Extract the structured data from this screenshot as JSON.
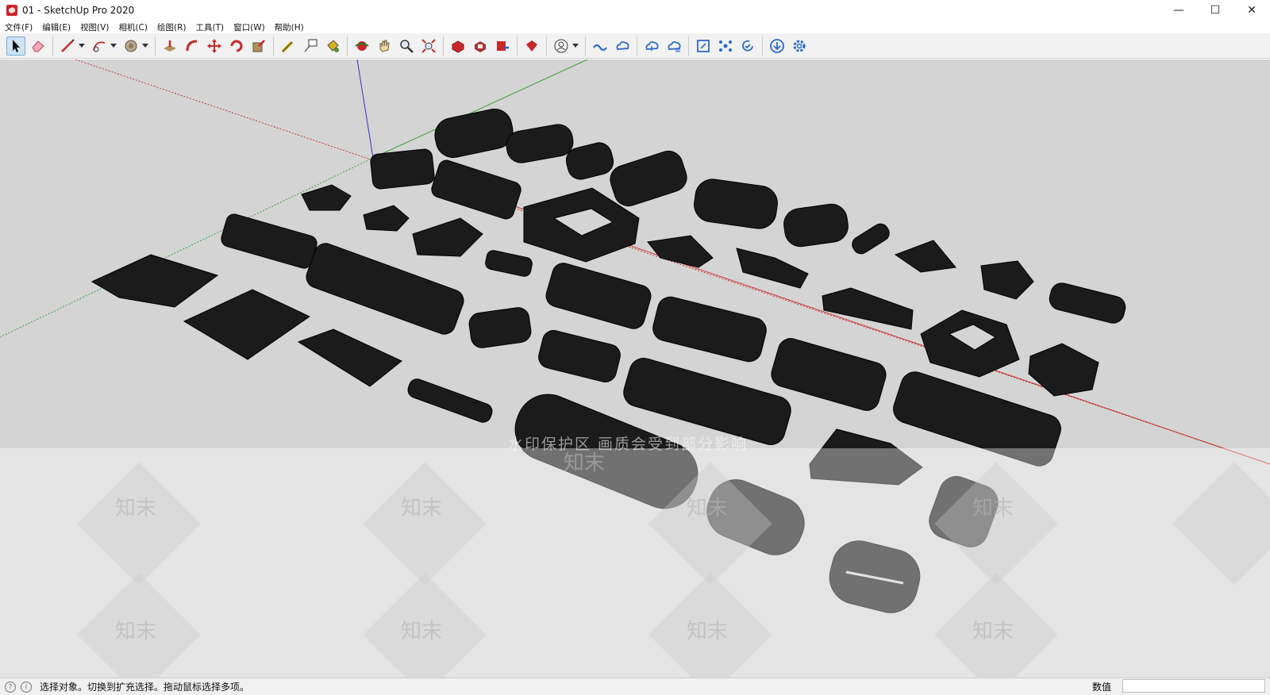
{
  "window": {
    "title": "01 - SketchUp Pro 2020",
    "controls": {
      "minimize": "—",
      "maximize": "☐",
      "close": "✕"
    }
  },
  "menu": [
    {
      "label": "文件(F)"
    },
    {
      "label": "编辑(E)"
    },
    {
      "label": "视图(V)"
    },
    {
      "label": "相机(C)"
    },
    {
      "label": "绘图(R)"
    },
    {
      "label": "工具(T)"
    },
    {
      "label": "窗口(W)"
    },
    {
      "label": "帮助(H)"
    }
  ],
  "toolbar": {
    "tools": [
      {
        "name": "select-tool-icon",
        "active": true
      },
      {
        "name": "eraser-tool-icon"
      },
      {
        "name": "line-tool-icon",
        "dropdown": true
      },
      {
        "name": "arc-tool-icon",
        "dropdown": true
      },
      {
        "name": "shape-tool-icon",
        "dropdown": true
      },
      {
        "name": "push-pull-tool-icon"
      },
      {
        "name": "follow-me-tool-icon"
      },
      {
        "name": "move-tool-icon"
      },
      {
        "name": "rotate-tool-icon"
      },
      {
        "name": "scale-tool-icon"
      },
      {
        "name": "tape-measure-tool-icon"
      },
      {
        "name": "text-tool-icon"
      },
      {
        "name": "paint-bucket-tool-icon"
      },
      {
        "name": "orbit-tool-icon"
      },
      {
        "name": "pan-tool-icon"
      },
      {
        "name": "zoom-tool-icon"
      },
      {
        "name": "zoom-extents-tool-icon"
      },
      {
        "name": "3d-warehouse-icon"
      },
      {
        "name": "extension-warehouse-icon"
      },
      {
        "name": "send-to-layout-icon"
      },
      {
        "name": "extension-manager-icon"
      },
      {
        "name": "account-icon",
        "dropdown": true
      },
      {
        "name": "trimble-connect-icon"
      },
      {
        "name": "cloud-share-icon"
      },
      {
        "name": "cloud-upload-icon"
      },
      {
        "name": "cloud-sync-icon"
      },
      {
        "name": "export-icon"
      },
      {
        "name": "network-icon"
      },
      {
        "name": "refresh-check-icon"
      },
      {
        "name": "download-icon"
      },
      {
        "name": "settings-gear-icon"
      }
    ]
  },
  "viewport": {
    "background": "#d4d4d4",
    "axis_colors": {
      "red": "#c83232",
      "green": "#3aa03a",
      "blue": "#3232c8"
    },
    "watermark_top": "水印保护区 画质会受到部分影响",
    "watermark_word": "知末"
  },
  "status": {
    "hint": "选择对象。切换到扩充选择。拖动鼠标选择多项。",
    "measurements_label": "数值",
    "measurements_value": ""
  }
}
